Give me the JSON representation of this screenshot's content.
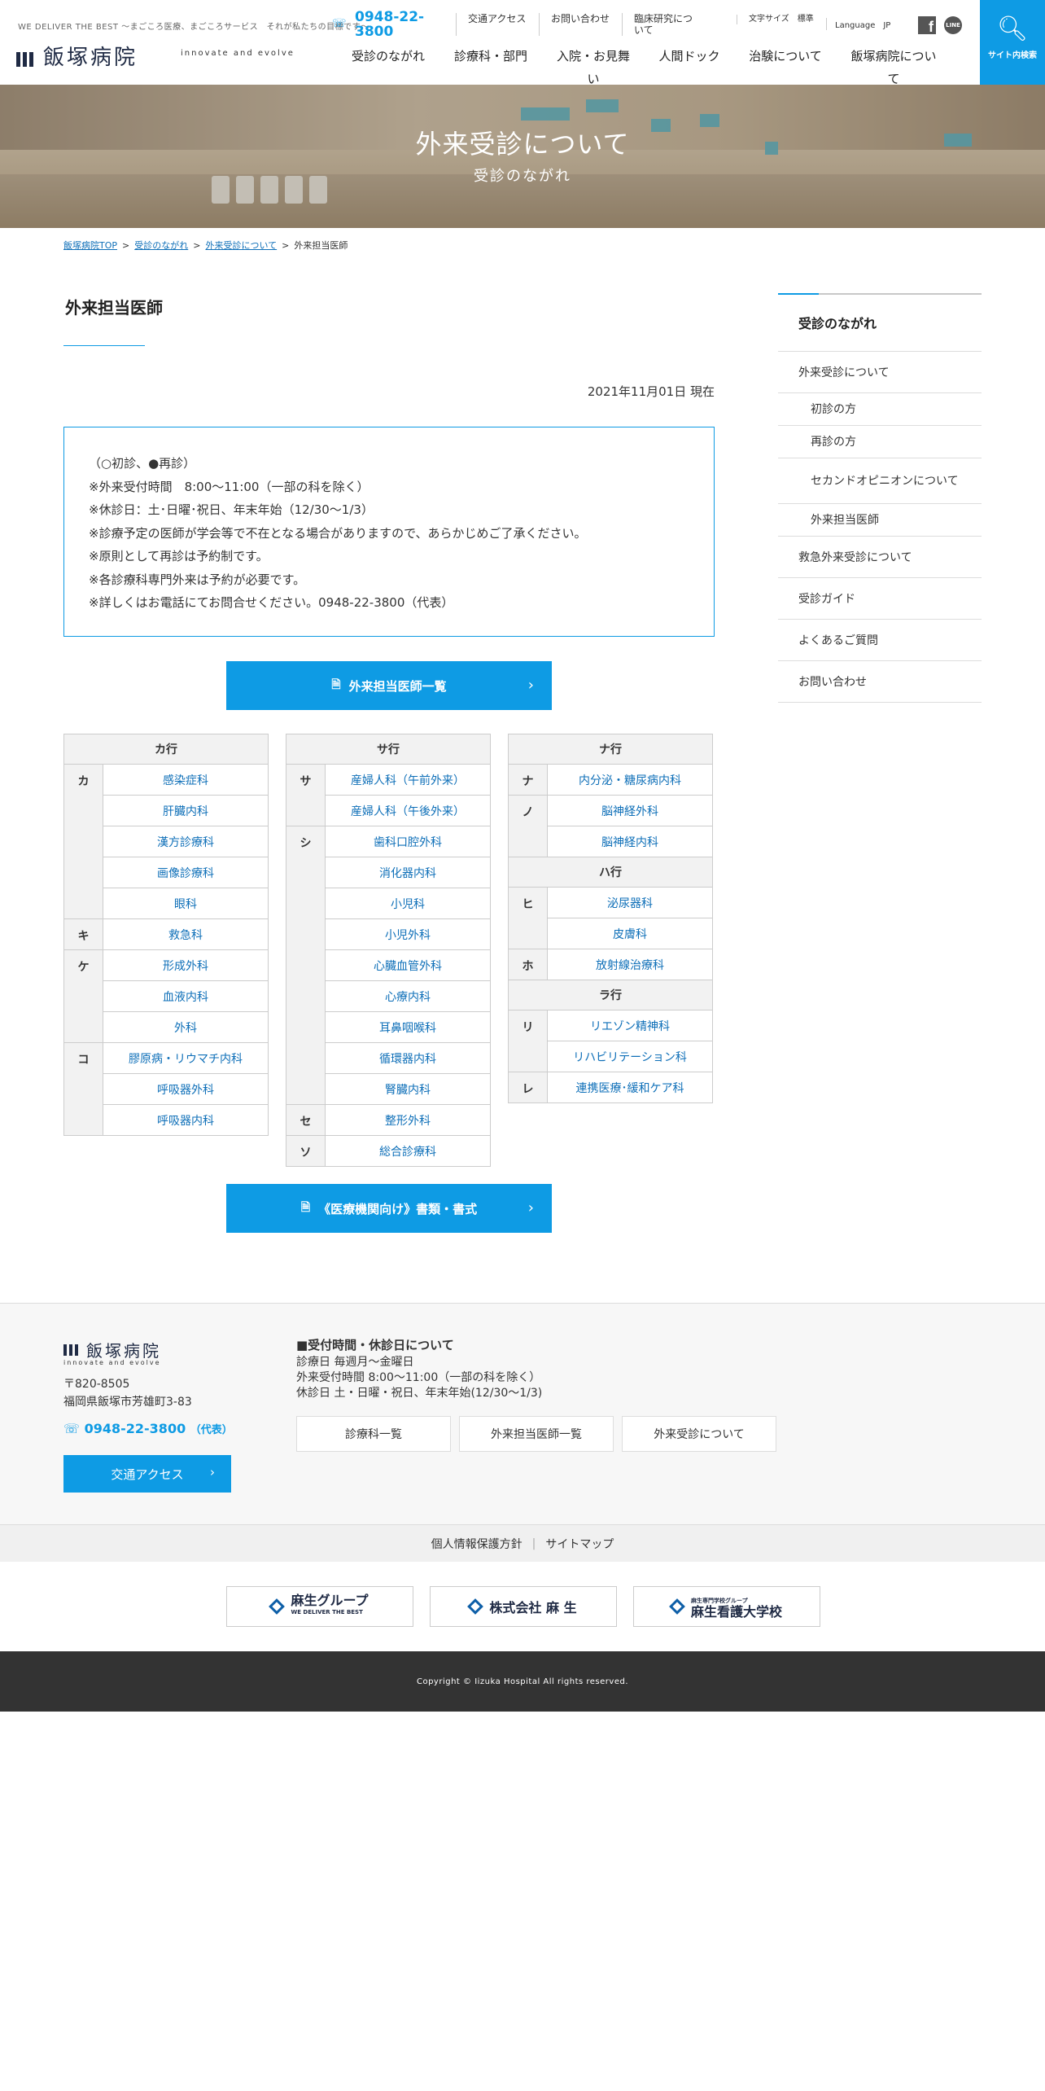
{
  "header": {
    "tagline": "WE DELIVER THE BEST ～まごころ医療、まごころサービス　それが私たちの目標です～",
    "logo_text": "飯塚病院",
    "motto": "innovate and evolve",
    "phone": "0948-22-3800",
    "top_links": [
      "交通アクセス",
      "お問い合わせ",
      "臨床研究について"
    ],
    "font_size_label": "文字サイズ　標準",
    "language_label": "Language　JP",
    "line_label": "LINE",
    "search_label": "サイト内検索",
    "nav": [
      "受診のながれ",
      "診療科・部門",
      "入院・お見舞い",
      "人間ドック",
      "治験について",
      "飯塚病院について"
    ]
  },
  "hero": {
    "title": "外来受診について",
    "subtitle": "受診のながれ"
  },
  "breadcrumb": {
    "items": [
      "飯塚病院TOP",
      "受診のながれ",
      "外来受診について"
    ],
    "current": "外来担当医師"
  },
  "main": {
    "title": "外来担当医師",
    "date": "2021年11月01日 現在",
    "notice": [
      "（○初診、●再診）",
      "※外来受付時間　8:00～11:00（一部の科を除く）",
      "※休診日：土･日曜･祝日、年末年始（12/30～1/3）",
      "※診療予定の医師が学会等で不在となる場合がありますので、あらかじめご了承ください。",
      "※原則として再診は予約制です。",
      "※各診療科専門外来は予約が必要です。",
      "※詳しくはお電話にてお問合せください。0948-22-3800（代表）"
    ],
    "button1": "外来担当医師一覧",
    "button2": "《医療機関向け》書類・書式"
  },
  "dept_tables": {
    "ka": {
      "header": "カ行",
      "rows": [
        {
          "k": "カ",
          "items": [
            "感染症科",
            "肝臓内科",
            "漢方診療科",
            "画像診療科",
            "眼科"
          ]
        },
        {
          "k": "キ",
          "items": [
            "救急科"
          ]
        },
        {
          "k": "ケ",
          "items": [
            "形成外科",
            "血液内科",
            "外科"
          ]
        },
        {
          "k": "コ",
          "items": [
            "膠原病・リウマチ内科",
            "呼吸器外科",
            "呼吸器内科"
          ]
        }
      ]
    },
    "sa": {
      "header": "サ行",
      "rows": [
        {
          "k": "サ",
          "items": [
            "産婦人科（午前外来）",
            "産婦人科（午後外来）"
          ]
        },
        {
          "k": "シ",
          "items": [
            "歯科口腔外科",
            "消化器内科",
            "小児科",
            "小児外科",
            "心臓血管外科",
            "心療内科",
            "耳鼻咽喉科",
            "循環器内科",
            "腎臓内科"
          ]
        },
        {
          "k": "セ",
          "items": [
            "整形外科"
          ]
        },
        {
          "k": "ソ",
          "items": [
            "総合診療科"
          ]
        }
      ]
    },
    "na": {
      "header": "ナ行",
      "rows": [
        {
          "k": "ナ",
          "items": [
            "内分泌・糖尿病内科"
          ]
        },
        {
          "k": "ノ",
          "items": [
            "脳神経外科",
            "脳神経内科"
          ]
        }
      ]
    },
    "ha": {
      "header": "ハ行",
      "rows": [
        {
          "k": "ヒ",
          "items": [
            "泌尿器科",
            "皮膚科"
          ]
        },
        {
          "k": "ホ",
          "items": [
            "放射線治療科"
          ]
        }
      ]
    },
    "ra": {
      "header": "ラ行",
      "rows": [
        {
          "k": "リ",
          "items": [
            "リエゾン精神科",
            "リハビリテーション科"
          ]
        },
        {
          "k": "レ",
          "items": [
            "連携医療･緩和ケア科"
          ]
        }
      ]
    }
  },
  "sidebar": {
    "title": "受診のながれ",
    "items": [
      {
        "label": "外来受診について",
        "level": 1
      },
      {
        "label": "初診の方",
        "level": 2
      },
      {
        "label": "再診の方",
        "level": 2
      },
      {
        "label": "セカンドオピニオンについて",
        "level": 2
      },
      {
        "label": "外来担当医師",
        "level": 2
      },
      {
        "label": "救急外来受診について",
        "level": 1
      },
      {
        "label": "受診ガイド",
        "level": 1
      },
      {
        "label": "よくあるご質問",
        "level": 1
      },
      {
        "label": "お問い合わせ",
        "level": 1
      }
    ]
  },
  "footer": {
    "logo_text": "飯塚病院",
    "motto": "innovate and evolve",
    "postal": "〒820-8505",
    "address": "福岡県飯塚市芳雄町3-83",
    "phone": "0948-22-3800",
    "phone_suffix": "（代表）",
    "access_button": "交通アクセス",
    "hours_title": "■受付時間・休診日について",
    "hours": [
      "診療日 毎週月～金曜日",
      "外来受付時間 8:00～11:00（一部の科を除く）",
      "休診日 土・日曜・祝日、年末年始(12/30～1/3)"
    ],
    "buttons": [
      "診療科一覧",
      "外来担当医師一覧",
      "外来受診について"
    ],
    "legal": [
      "個人情報保護方針",
      "サイトマップ"
    ],
    "group": [
      "麻生グループ",
      "株式会社 麻 生",
      "麻生看護大学校"
    ],
    "group_sub": [
      "WE DELIVER THE BEST",
      "",
      "麻生専門学校グループ"
    ],
    "copyright": "Copyright © Iizuka Hospital All rights reserved."
  },
  "colors": {
    "accent": "#0e9be4",
    "link": "#0e6fb8",
    "dark": "#333333"
  }
}
